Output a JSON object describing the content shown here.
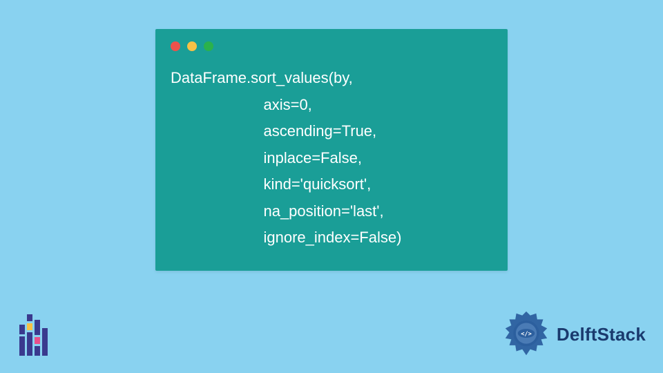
{
  "code": {
    "lines": [
      "DataFrame.sort_values(by,",
      "                      axis=0,",
      "                      ascending=True,",
      "                      inplace=False,",
      "                      kind='quicksort',",
      "                      na_position='last',",
      "                      ignore_index=False)"
    ]
  },
  "brand": {
    "name": "DelftStack"
  },
  "colors": {
    "bg": "#89d2f0",
    "window": "#1a9e97",
    "brandText": "#1a3a6e"
  }
}
